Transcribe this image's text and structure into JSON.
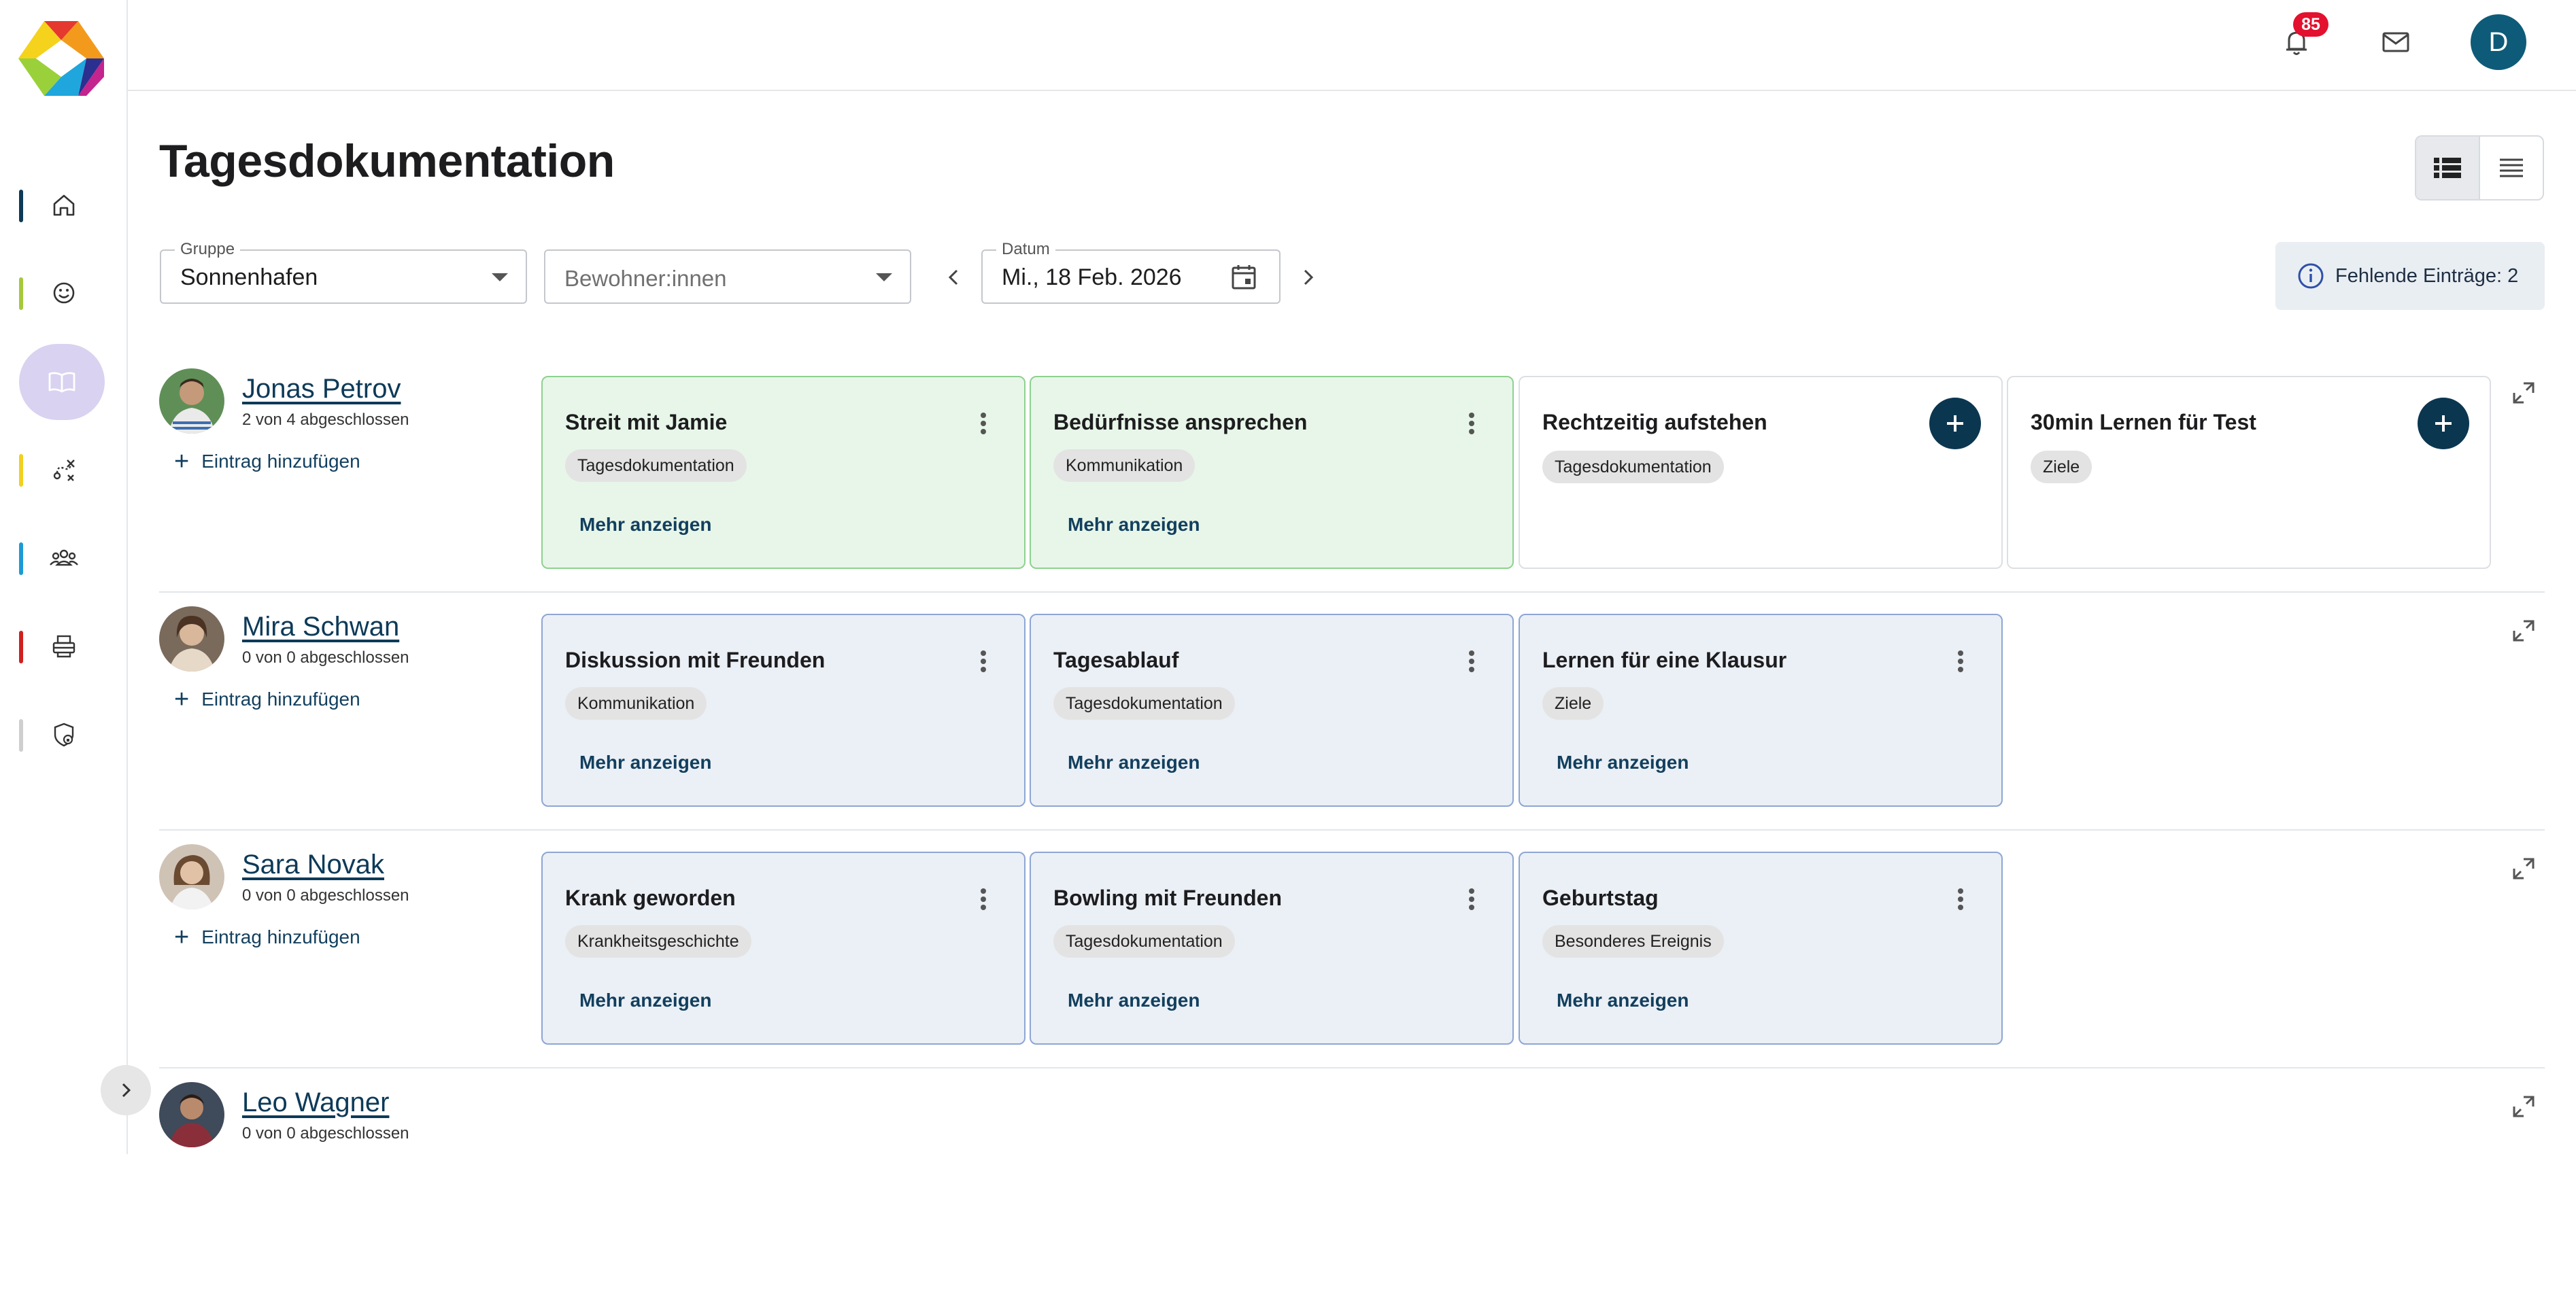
{
  "header": {
    "notification_count": "85",
    "user_initial": "D"
  },
  "page": {
    "title": "Tagesdokumentation"
  },
  "filters": {
    "group_label": "Gruppe",
    "group_value": "Sonnenhafen",
    "residents_placeholder": "Bewohner:innen",
    "date_label": "Datum",
    "date_value": "Mi., 18 Feb. 2026",
    "missing_entries": "Fehlende Einträge: 2"
  },
  "add_entry_label": "Eintrag hinzufügen",
  "more_label": "Mehr anzeigen",
  "colors": {
    "accent": "#0b3650",
    "completed_card": "#e8f6e9",
    "entry_card": "#ebf0f6",
    "badge": "#e3102e",
    "nav_active": "#d9d2f0"
  },
  "sidebar": {
    "items": [
      {
        "icon": "home-icon",
        "bar_color": "#0d3a58"
      },
      {
        "icon": "smiley-icon",
        "bar_color": "#a6c93c"
      },
      {
        "icon": "book-icon",
        "bar_color": "",
        "active": true
      },
      {
        "icon": "route-icon",
        "bar_color": "#f0d020"
      },
      {
        "icon": "people-icon",
        "bar_color": "#1d9ad6"
      },
      {
        "icon": "printer-icon",
        "bar_color": "#d0201f"
      },
      {
        "icon": "shield-lock-icon",
        "bar_color": "#cfcfcf"
      }
    ]
  },
  "residents": [
    {
      "name": "Jonas Petrov",
      "progress": "2 von 4 abgeschlossen",
      "cards": [
        {
          "title": "Streit mit Jamie",
          "tag": "Tagesdokumentation",
          "state": "green"
        },
        {
          "title": "Bedürfnisse ansprechen",
          "tag": "Kommunikation",
          "state": "green"
        },
        {
          "title": "Rechtzeitig aufstehen",
          "tag": "Tagesdokumentation",
          "state": "white"
        },
        {
          "title": "30min Lernen für Test",
          "tag": "Ziele",
          "state": "white"
        }
      ]
    },
    {
      "name": "Mira Schwan",
      "progress": "0 von 0 abgeschlossen",
      "cards": [
        {
          "title": "Diskussion mit Freunden",
          "tag": "Kommunikation",
          "state": "blue"
        },
        {
          "title": "Tagesablauf",
          "tag": "Tagesdokumentation",
          "state": "blue"
        },
        {
          "title": "Lernen für eine Klausur",
          "tag": "Ziele",
          "state": "blue"
        }
      ]
    },
    {
      "name": "Sara Novak",
      "progress": "0 von 0 abgeschlossen",
      "cards": [
        {
          "title": "Krank geworden",
          "tag": "Krankheitsgeschichte",
          "state": "blue"
        },
        {
          "title": "Bowling mit Freunden",
          "tag": "Tagesdokumentation",
          "state": "blue"
        },
        {
          "title": "Geburtstag",
          "tag": "Besonderes Ereignis",
          "state": "blue"
        }
      ]
    },
    {
      "name": "Leo Wagner",
      "progress": "0 von 0 abgeschlossen",
      "cards": []
    }
  ]
}
